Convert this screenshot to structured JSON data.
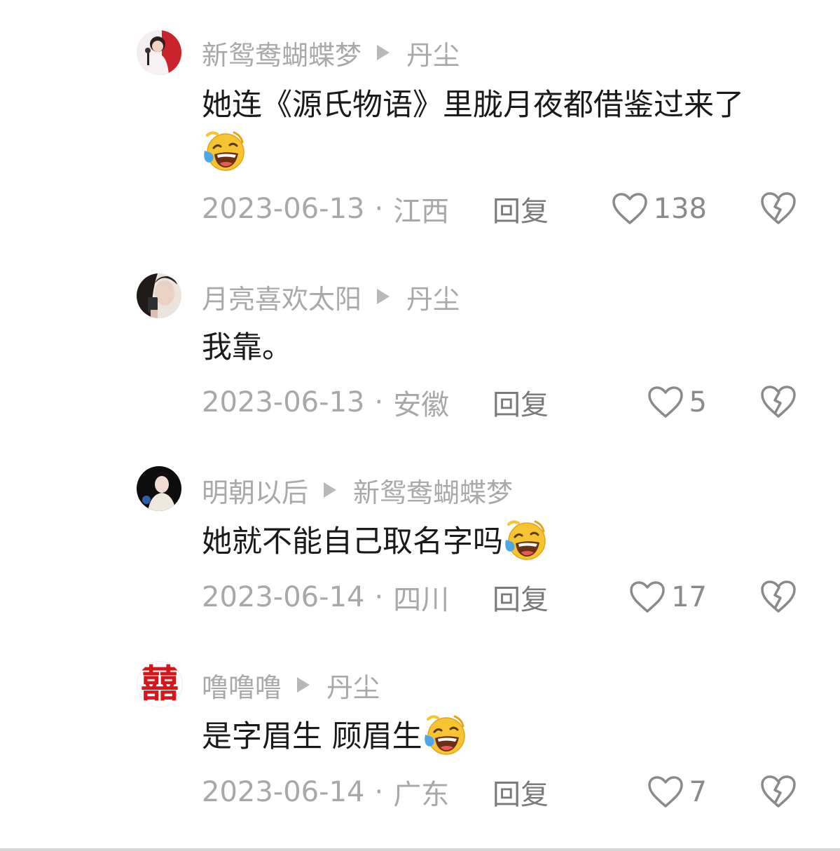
{
  "comments": [
    {
      "author": "新鸳鸯蝴蝶梦",
      "reply_to": "丹尘",
      "text": "她连《源氏物语》里胧月夜都借鉴过来了",
      "emoji": "laugh-cry-emoji",
      "date": "2023-06-13",
      "location": "江西",
      "reply_label": "回复",
      "likes": "138"
    },
    {
      "author": "月亮喜欢太阳",
      "reply_to": "丹尘",
      "text": "我靠。",
      "date": "2023-06-13",
      "location": "安徽",
      "reply_label": "回复",
      "likes": "5"
    },
    {
      "author": "明朝以后",
      "reply_to": "新鸳鸯蝴蝶梦",
      "text": "她就不能自己取名字吗",
      "emoji": "laugh-cry-emoji",
      "date": "2023-06-14",
      "location": "四川",
      "reply_label": "回复",
      "likes": "17"
    },
    {
      "author": "噜噜噜",
      "reply_to": "丹尘",
      "text": "是字眉生 顾眉生",
      "emoji": "laugh-cry-emoji",
      "date": "2023-06-14",
      "location": "广东",
      "reply_label": "回复",
      "likes": "7"
    }
  ],
  "separator": "·",
  "avatar4_text": "囍",
  "icons": {
    "like": "heart-outline-icon",
    "dislike": "broken-heart-icon",
    "reply_to": "triangle-arrow-icon"
  },
  "colors": {
    "name": "#a9a9a9",
    "text": "#1a1a1a",
    "meta": "#a8a8a8",
    "avatar4_red": "#d7161b"
  }
}
